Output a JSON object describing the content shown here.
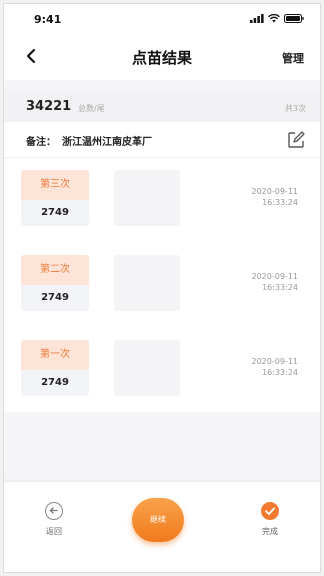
{
  "status": {
    "time": "9:41"
  },
  "nav": {
    "title": "点苗结果",
    "manage_label": "管理"
  },
  "summary": {
    "count": "34221",
    "unit": "总数/尾",
    "total": "共3次"
  },
  "remark": {
    "label": "备注：",
    "value": "浙江温州江南皮革厂"
  },
  "records": [
    {
      "round": "第三次",
      "count": "2749",
      "date": "2020-09-11",
      "time": "16:33:24"
    },
    {
      "round": "第二次",
      "count": "2749",
      "date": "2020-09-11",
      "time": "16:33:24"
    },
    {
      "round": "第一次",
      "count": "2749",
      "date": "2020-09-11",
      "time": "16:33:24"
    }
  ],
  "bottom": {
    "back_label": "返回",
    "continue_label": "继续",
    "done_label": "完成"
  },
  "colors": {
    "accent": "#f07a3a",
    "badge_bg": "#fde4d6"
  }
}
